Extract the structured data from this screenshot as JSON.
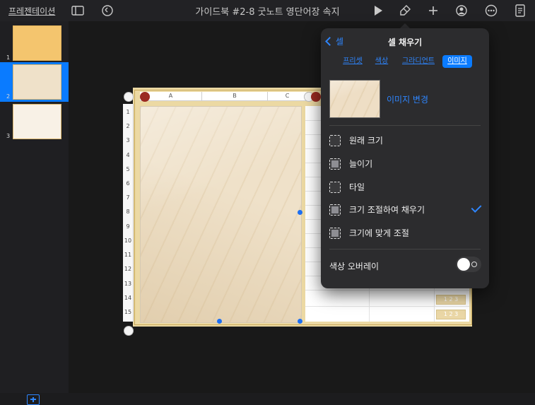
{
  "header": {
    "documents_link": "프레젠테이션",
    "title": "가이드북 #2-8 굿노트 영단어장 속지"
  },
  "toolbar": {
    "icons": [
      "sidebar-toggle-icon",
      "undo-icon",
      "play-icon",
      "format-brush-icon",
      "add-icon",
      "collaborate-icon",
      "more-icon",
      "document-options-icon"
    ]
  },
  "sidebar": {
    "slides": [
      {
        "number": "1",
        "selected": false
      },
      {
        "number": "2",
        "selected": true
      },
      {
        "number": "3",
        "selected": false
      }
    ]
  },
  "table": {
    "column_headers": [
      "A",
      "B",
      "C"
    ],
    "row_numbers": [
      "1",
      "2",
      "3",
      "4",
      "5",
      "6",
      "7",
      "8",
      "9",
      "10",
      "11",
      "12",
      "13",
      "14",
      "15"
    ],
    "badges": [
      "1 2 3",
      "1 2 3"
    ]
  },
  "popover": {
    "back_label": "셀",
    "title": "셀 채우기",
    "tabs": [
      {
        "label": "프리셋",
        "active": false
      },
      {
        "label": "색상",
        "active": false
      },
      {
        "label": "그라디언트",
        "active": false
      },
      {
        "label": "이미지",
        "active": true
      }
    ],
    "change_image_label": "이미지 변경",
    "options": [
      {
        "label": "원래 크기",
        "checked": false
      },
      {
        "label": "늘이기",
        "checked": false
      },
      {
        "label": "타일",
        "checked": false
      },
      {
        "label": "크기 조절하여 채우기",
        "checked": true
      },
      {
        "label": "크기에 맞게 조절",
        "checked": false
      }
    ],
    "overlay_label": "색상 오버레이",
    "overlay_on": false
  },
  "colors": {
    "accent": "#0a7bff",
    "slide_frame": "#ecd9a3",
    "marble": "#efe1c9",
    "pill": "#9b2a22"
  }
}
